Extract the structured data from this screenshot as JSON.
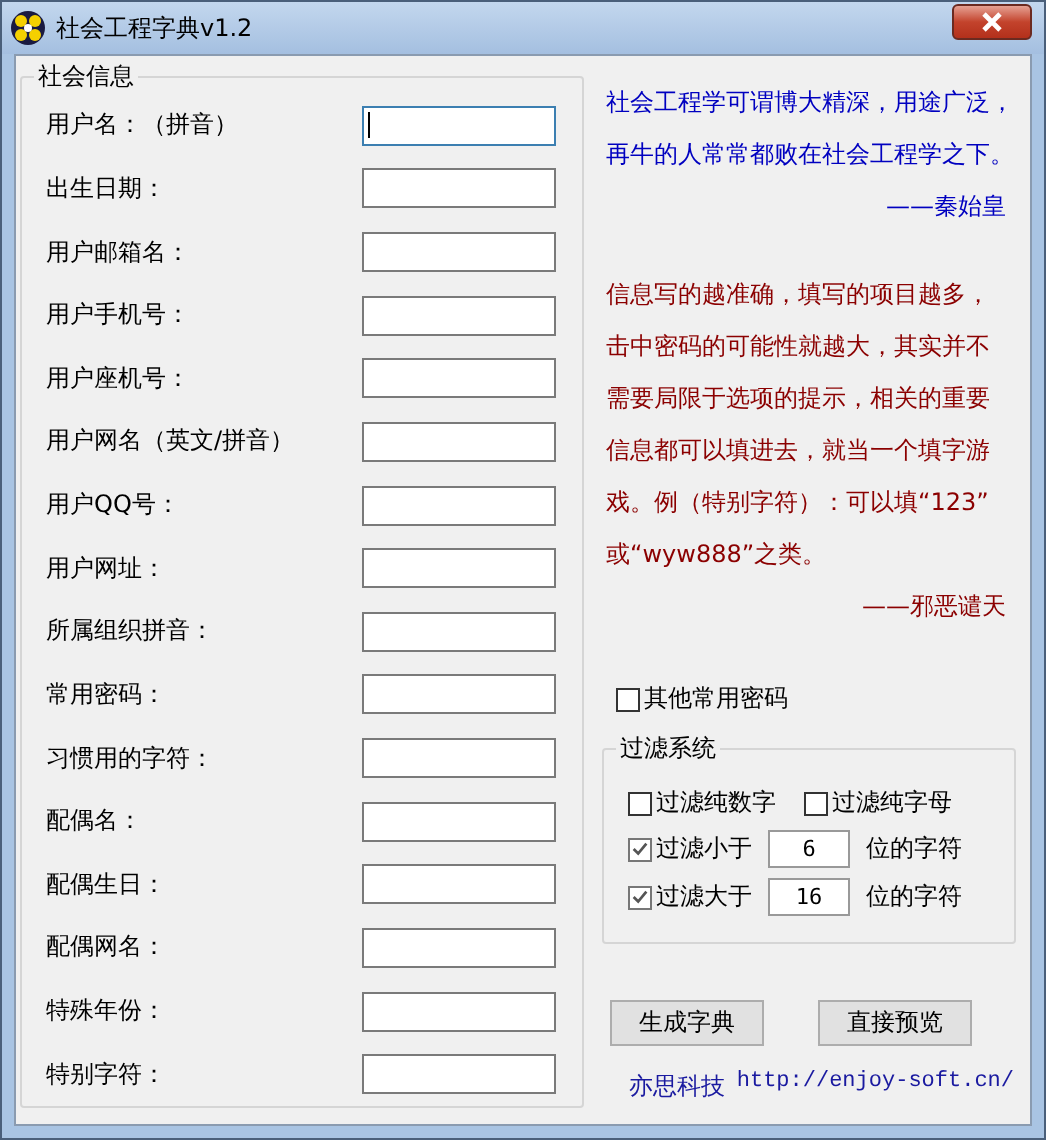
{
  "window": {
    "title": "社会工程字典v1.2"
  },
  "info_group": {
    "title": "社会信息",
    "fields": [
      {
        "label": "用户名：（拼音）",
        "focused": true
      },
      {
        "label": "出生日期：",
        "focused": false
      },
      {
        "label": "用户邮箱名：",
        "focused": false
      },
      {
        "label": "用户手机号：",
        "focused": false
      },
      {
        "label": "用户座机号：",
        "focused": false
      },
      {
        "label": "用户网名（英文/拼音）",
        "focused": false
      },
      {
        "label": "用户QQ号：",
        "focused": false
      },
      {
        "label": "用户网址：",
        "focused": false
      },
      {
        "label": "所属组织拼音：",
        "focused": false
      },
      {
        "label": "常用密码：",
        "focused": false
      },
      {
        "label": "习惯用的字符：",
        "focused": false
      },
      {
        "label": "配偶名：",
        "focused": false
      },
      {
        "label": "配偶生日：",
        "focused": false
      },
      {
        "label": "配偶网名：",
        "focused": false
      },
      {
        "label": "特殊年份：",
        "focused": false
      },
      {
        "label": "特别字符：",
        "focused": false
      }
    ]
  },
  "quotes": [
    {
      "lines": [
        "社会工程学可谓博大精深，用途广泛，",
        "再牛的人常常都败在社会工程学之下。"
      ],
      "author": "——秦始皇",
      "color": "#0000c0"
    },
    {
      "lines": [
        "信息写的越准确，填写的项目越多，",
        "击中密码的可能性就越大，其实并不",
        "需要局限于选项的提示，相关的重要",
        "信息都可以填进去，就当一个填字游",
        "戏。例（特别字符）：可以填“123”",
        "或“wyw888”之类。"
      ],
      "author": "——邪恶谴天",
      "color": "#8b0000"
    }
  ],
  "other_passwords": {
    "label": "其他常用密码",
    "checked": false
  },
  "filter_group": {
    "title": "过滤系统",
    "pure": [
      {
        "label": "过滤纯数字",
        "checked": false
      },
      {
        "label": "过滤纯字母",
        "checked": false
      }
    ],
    "length": [
      {
        "label": "过滤小于",
        "checked": true,
        "value": "6",
        "suffix": "位的字符"
      },
      {
        "label": "过滤大于",
        "checked": true,
        "value": "16",
        "suffix": "位的字符"
      }
    ]
  },
  "buttons": [
    "生成字典",
    "直接预览"
  ],
  "footer": {
    "company": "亦思科技",
    "url": "http://enjoy-soft.cn/"
  }
}
